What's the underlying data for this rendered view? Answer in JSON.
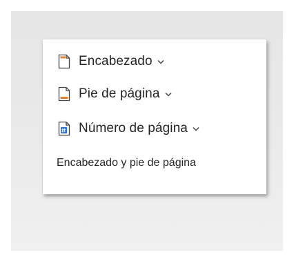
{
  "header_footer_group": {
    "commands": [
      {
        "label": "Encabezado",
        "icon": "header-icon"
      },
      {
        "label": "Pie de página",
        "icon": "footer-icon"
      },
      {
        "label": "Número de página",
        "icon": "page-number-icon"
      }
    ],
    "group_label": "Encabezado y pie de página"
  },
  "colors": {
    "accent_orange": "#e8822a",
    "accent_blue": "#2b6cc4",
    "icon_outline": "#444444"
  }
}
